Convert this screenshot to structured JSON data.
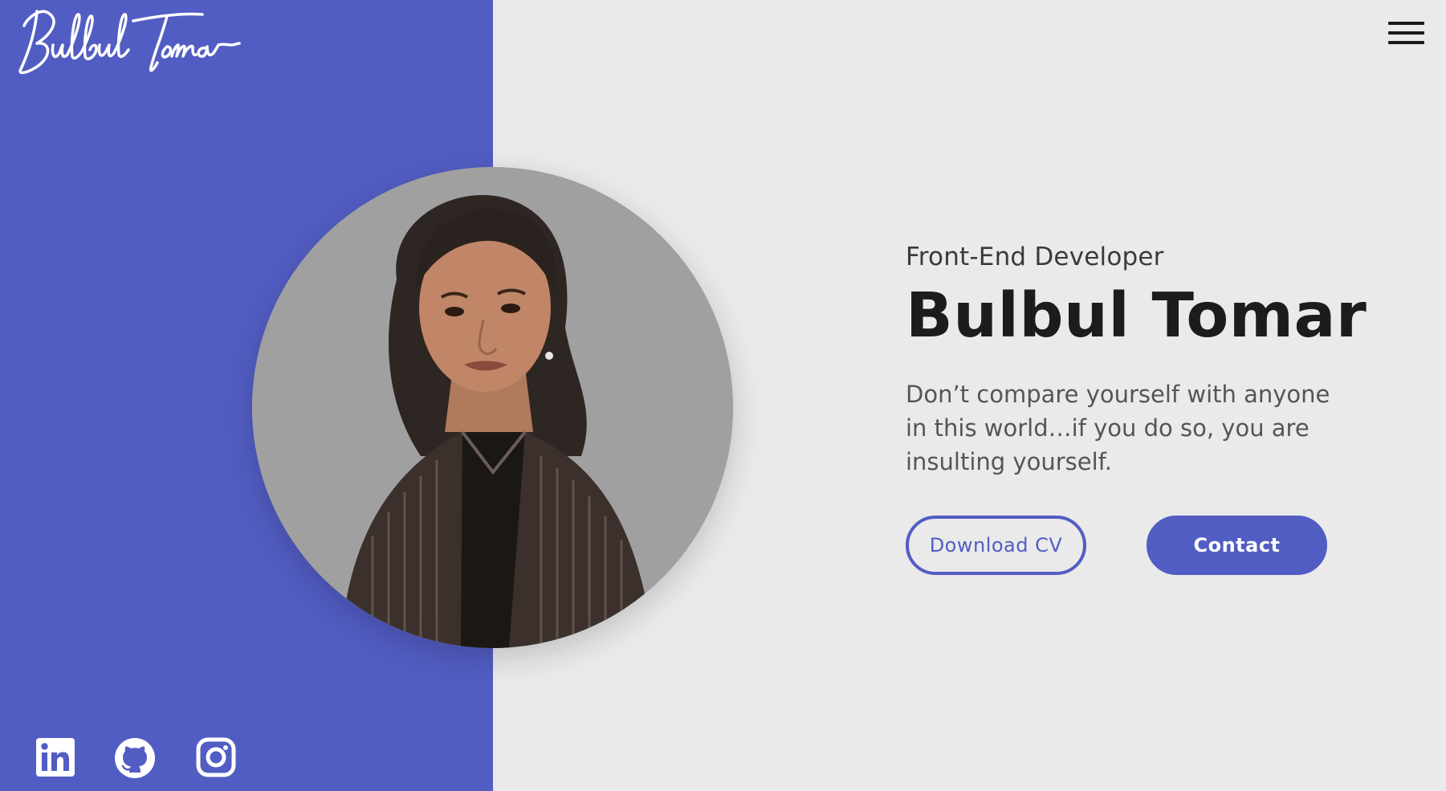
{
  "brand": {
    "logo_text": "Bulbul Tomar"
  },
  "header": {
    "menu_icon": "hamburger-menu-icon"
  },
  "hero": {
    "role": "Front-End Developer",
    "name": "Bulbul Tomar",
    "quote": "Don’t compare yourself with anyone in this world…if you do so, you are insulting yourself.",
    "download_cv_label": "Download CV",
    "contact_label": "Contact"
  },
  "social": {
    "icons": [
      "linkedin-icon",
      "github-icon",
      "instagram-icon"
    ]
  },
  "colors": {
    "accent": "#525dc3",
    "background": "#eaeaea",
    "text_dark": "#1c1c1c",
    "portrait_bg": "#a0a0a0"
  }
}
